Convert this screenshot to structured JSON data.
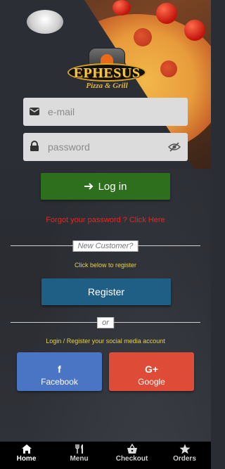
{
  "brand": {
    "name": "EPHESUS",
    "tagline": "Pizza & Grill"
  },
  "login": {
    "email_placeholder": "e-mail",
    "password_placeholder": "password",
    "login_label": "Log in",
    "forgot_text": "Forgot your password ? Click Here"
  },
  "register": {
    "divider_label": "New Customer?",
    "hint": "Click below to register",
    "button_label": "Register"
  },
  "social": {
    "divider_label": "or",
    "hint": "Login / Register your social media account",
    "facebook_label": "Facebook",
    "google_label": "Google",
    "facebook_icon": "f",
    "google_icon": "G+"
  },
  "nav": {
    "items": [
      {
        "label": "Home",
        "icon": "home-icon",
        "active": true
      },
      {
        "label": "Menu",
        "icon": "cutlery-icon",
        "active": false
      },
      {
        "label": "Checkout",
        "icon": "basket-icon",
        "active": false
      },
      {
        "label": "Orders",
        "icon": "star-icon",
        "active": false
      }
    ]
  },
  "colors": {
    "login_button": "#2d6f1d",
    "register_button": "#1f5f86",
    "facebook": "#4a74c4",
    "google": "#de4b36",
    "forgot_text": "#e8261d",
    "hint_text": "#e6d24a"
  }
}
